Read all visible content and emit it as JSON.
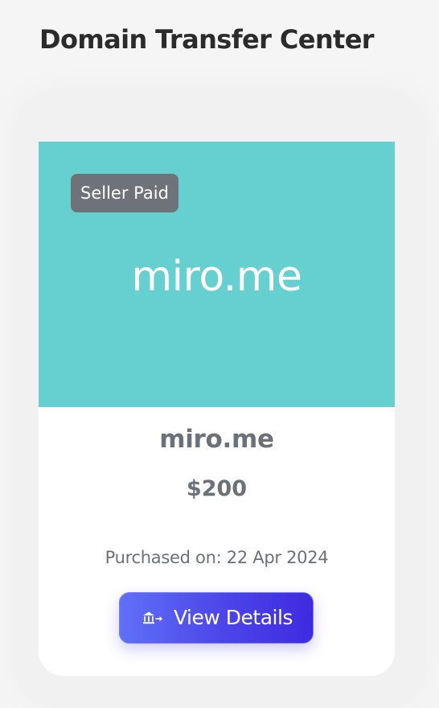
{
  "header": {
    "title": "Domain Transfer Center"
  },
  "card": {
    "badge": "Seller Paid",
    "banner_domain": "miro.me",
    "domain": "miro.me",
    "price": "$200",
    "purchased_label": "Purchased on:",
    "purchased_date": "22 Apr 2024",
    "button_label": "View Details",
    "button_icon": "bank-transfer-icon",
    "banner_color": "#66d0d0",
    "badge_color": "#6e737a",
    "button_gradient": [
      "#6070f7",
      "#3f2ae0"
    ]
  }
}
